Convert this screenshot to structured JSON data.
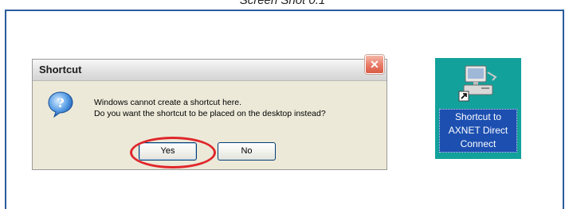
{
  "caption": "Screen Shot 0.1",
  "dialog": {
    "title": "Shortcut",
    "close_label": "✕",
    "message_line1": "Windows cannot create a shortcut here.",
    "message_line2": "Do you want the shortcut to be placed on the desktop instead?",
    "yes_label": "Yes",
    "no_label": "No",
    "icon": "question-icon"
  },
  "desktop_shortcut": {
    "icon": "computer-shortcut-icon",
    "label_line1": "Shortcut to",
    "label_line2": "AXNET Direct",
    "label_line3": "Connect"
  },
  "colors": {
    "frame_border": "#2a5c9c",
    "highlight_ring": "#e0262b",
    "desktop_background": "#13a19b",
    "label_selection": "#1c4fb0"
  }
}
